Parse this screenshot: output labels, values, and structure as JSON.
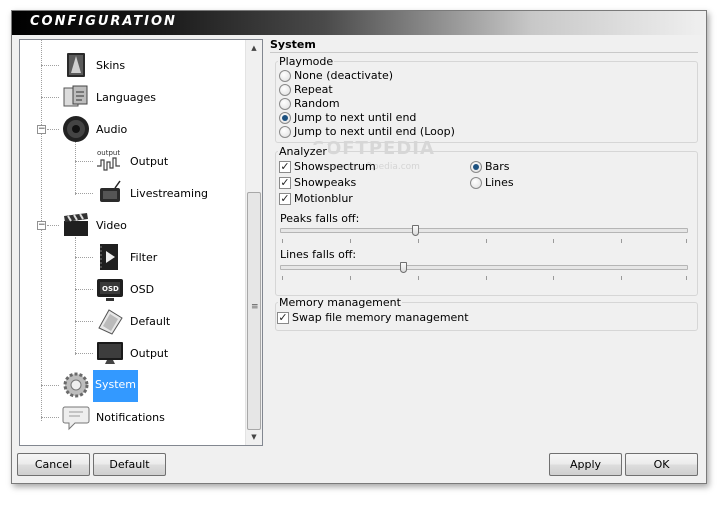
{
  "window": {
    "title": "CONFIGURATION"
  },
  "tree": {
    "items": [
      {
        "label": "Skins",
        "icon": "skins-icon"
      },
      {
        "label": "Languages",
        "icon": "languages-icon"
      },
      {
        "label": "Audio",
        "icon": "audio-speaker-icon",
        "expanded": true
      },
      {
        "label": "Output",
        "icon": "audio-output-icon",
        "icon_text": "output"
      },
      {
        "label": "Livestreaming",
        "icon": "livestreaming-icon"
      },
      {
        "label": "Video",
        "icon": "video-clapper-icon",
        "expanded": true
      },
      {
        "label": "Filter",
        "icon": "filter-icon"
      },
      {
        "label": "OSD",
        "icon": "osd-icon",
        "icon_text": "OSD"
      },
      {
        "label": "Default",
        "icon": "default-video-icon"
      },
      {
        "label": "Output",
        "icon": "video-output-monitor-icon"
      },
      {
        "label": "System",
        "icon": "system-gears-icon",
        "selected": true
      },
      {
        "label": "Notifications",
        "icon": "notifications-bubble-icon"
      }
    ]
  },
  "system": {
    "title": "System",
    "playmode": {
      "title": "Playmode",
      "options": [
        {
          "label": "None (deactivate)",
          "checked": false
        },
        {
          "label": "Repeat",
          "checked": false
        },
        {
          "label": "Random",
          "checked": false
        },
        {
          "label": "Jump to next until end",
          "checked": true
        },
        {
          "label": "Jump to next until end (Loop)",
          "checked": false
        }
      ]
    },
    "analyzer": {
      "title": "Analyzer",
      "checkboxes": [
        {
          "label": "Showspectrum",
          "checked": true
        },
        {
          "label": "Showpeaks",
          "checked": true
        },
        {
          "label": "Motionblur",
          "checked": true
        }
      ],
      "display": [
        {
          "label": "Bars",
          "checked": true
        },
        {
          "label": "Lines",
          "checked": false
        }
      ],
      "peaks_label": "Peaks falls off:",
      "peaks_value": 0.33,
      "lines_label": "Lines falls off:",
      "lines_value": 0.3
    },
    "memory": {
      "title": "Memory management",
      "swap_label": "Swap file memory management",
      "swap_checked": true
    }
  },
  "buttons": {
    "cancel": "Cancel",
    "default": "Default",
    "apply": "Apply",
    "ok": "OK"
  },
  "watermark": {
    "text": "SOFTPEDIA",
    "url": "www.softpedia.com"
  }
}
